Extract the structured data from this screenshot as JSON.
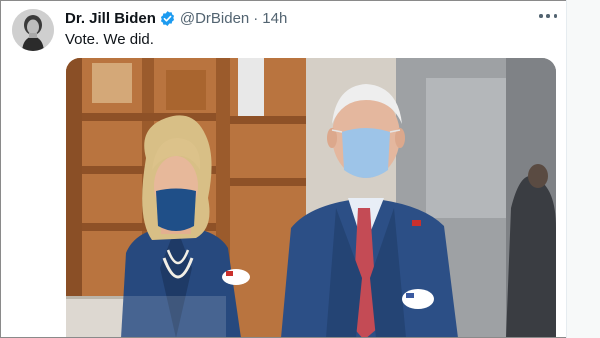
{
  "tweet": {
    "display_name": "Dr. Jill Biden",
    "handle": "@DrBiden",
    "separator": "·",
    "time": "14h",
    "text": "Vote. We did.",
    "verified": true
  },
  "icons": {
    "verified": "verified-badge-icon",
    "more": "more-options-icon"
  },
  "colors": {
    "verified_blue": "#1d9bf0",
    "secondary_text": "#536471",
    "primary_text": "#0f1419"
  }
}
